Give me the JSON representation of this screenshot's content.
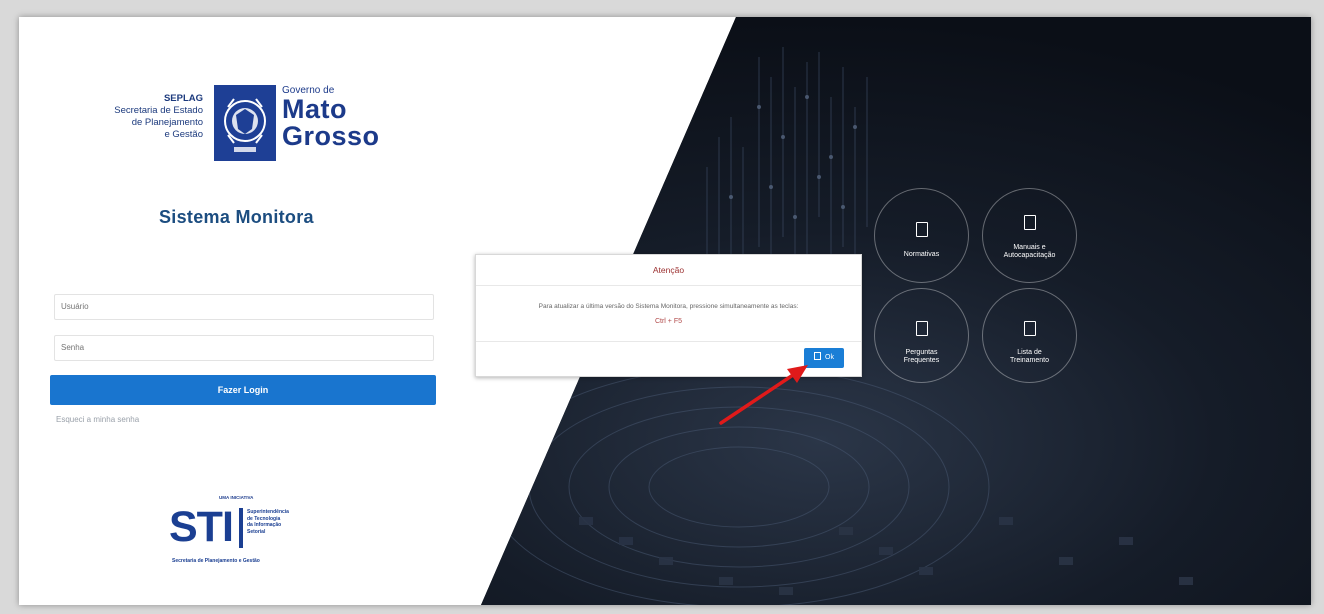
{
  "branding": {
    "seplag_lines": [
      "SEPLAG",
      "Secretaria de Estado",
      "de Planejamento",
      "e Gestão"
    ],
    "gov_small": "Governo de",
    "gov_line1": "Mato",
    "gov_line2": "Grosso"
  },
  "login": {
    "title": "Sistema Monitora",
    "user_placeholder": "Usuário",
    "password_placeholder": "Senha",
    "login_button": "Fazer Login",
    "forgot_link": "Esqueci a minha senha"
  },
  "sti": {
    "top": "UMA INICIATIVA",
    "big": "STI",
    "desc": [
      "Superintendência",
      "de Tecnologia",
      "da Informação",
      "Setorial"
    ],
    "foot": "Secretaria de Planejamento e Gestão"
  },
  "modal": {
    "title": "Atenção",
    "message": "Para atualizar a última versão do Sistema Monitora, pressione simultaneamente as teclas:",
    "keys": "Ctrl + F5",
    "ok_label": "Ok"
  },
  "links": [
    {
      "label": "Normativas"
    },
    {
      "label": "Manuais e Autocapacitação"
    },
    {
      "label": "Perguntas Frequentes"
    },
    {
      "label": "Lista de Treinamento"
    }
  ],
  "colors": {
    "primary_blue": "#1975cf",
    "title_blue": "#1c4d80",
    "alert_red": "#9b2f2f",
    "annotation_arrow": "#e01a1a"
  }
}
